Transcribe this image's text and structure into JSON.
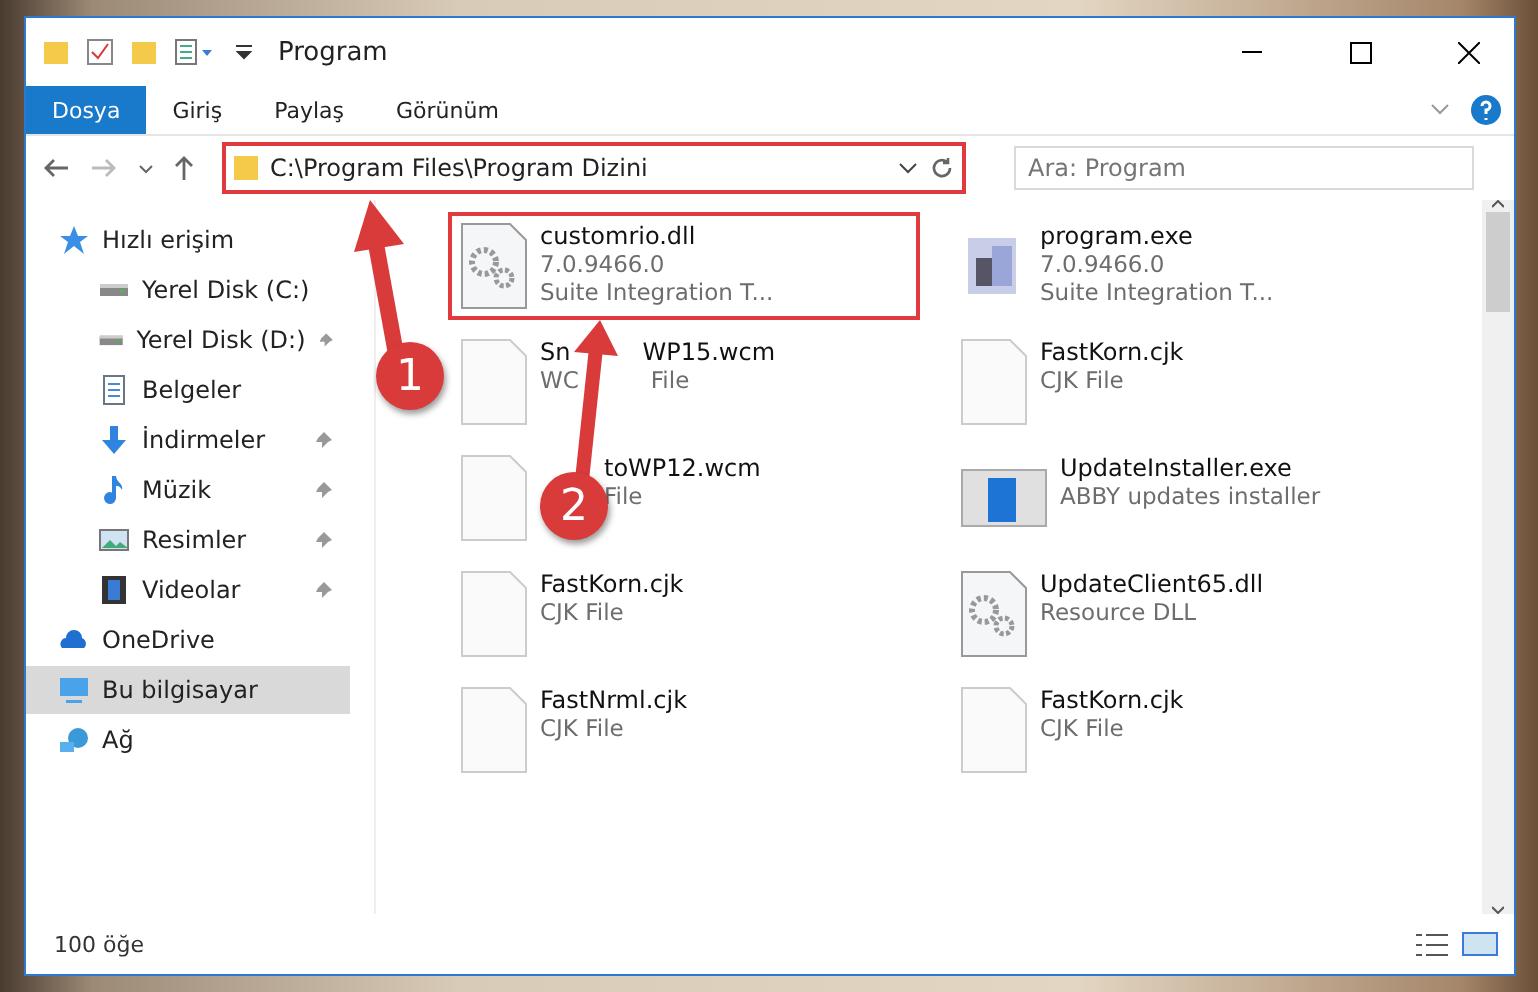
{
  "window": {
    "title": "Program"
  },
  "ribbon_tabs": [
    {
      "label": "Dosya",
      "selected": true
    },
    {
      "label": "Giriş",
      "selected": false
    },
    {
      "label": "Paylaş",
      "selected": false
    },
    {
      "label": "Görünüm",
      "selected": false
    }
  ],
  "address": {
    "path": "C:\\Program Files\\Program Dizini"
  },
  "search": {
    "placeholder": "Ara: Program"
  },
  "sidebar": {
    "items": [
      {
        "label": "Hızlı erişim",
        "kind": "star",
        "pinned": false,
        "selected": false,
        "children": [
          {
            "label": "Yerel Disk (C:)",
            "kind": "drive",
            "pinned": false,
            "selected": false
          },
          {
            "label": "Yerel Disk (D:)",
            "kind": "drive",
            "pinned": true,
            "selected": false
          },
          {
            "label": "Belgeler",
            "kind": "document",
            "pinned": false,
            "selected": false
          },
          {
            "label": "İndirmeler",
            "kind": "download",
            "pinned": true,
            "selected": false
          },
          {
            "label": "Müzik",
            "kind": "music",
            "pinned": true,
            "selected": false
          },
          {
            "label": "Resimler",
            "kind": "image",
            "pinned": true,
            "selected": false
          },
          {
            "label": "Videolar",
            "kind": "video",
            "pinned": true,
            "selected": false
          }
        ]
      },
      {
        "label": "OneDrive",
        "kind": "cloud",
        "pinned": false,
        "selected": false
      },
      {
        "label": "Bu bilgisayar",
        "kind": "computer",
        "pinned": false,
        "selected": true
      },
      {
        "label": "Ağ",
        "kind": "network",
        "pinned": false,
        "selected": false
      }
    ]
  },
  "files": [
    {
      "name": [
        "customrio.dll"
      ],
      "details": [
        [
          "7.0.9466.0"
        ],
        [
          "Suite Integration T..."
        ]
      ],
      "kind": "gear",
      "highlighted": true
    },
    {
      "name": [
        "program.exe"
      ],
      "details": [
        [
          "7.0.9466.0"
        ],
        [
          "Suite Integration T..."
        ]
      ],
      "kind": "app",
      "highlighted": false
    },
    {
      "name": [
        "Sn",
        "WP15.wcm"
      ],
      "details": [
        [
          "WC",
          "File"
        ]
      ],
      "kind": "blank",
      "highlighted": false
    },
    {
      "name": [
        "FastKorn.cjk"
      ],
      "details": [
        [
          "CJK File"
        ]
      ],
      "kind": "blank",
      "highlighted": false
    },
    {
      "name": [
        "toWP12.wcm"
      ],
      "details": [
        [
          "File"
        ]
      ],
      "kind": "blank",
      "highlighted": false
    },
    {
      "name": [
        "UpdateInstaller.exe"
      ],
      "details": [
        [
          "ABBY updates installer"
        ]
      ],
      "kind": "window",
      "highlighted": false
    },
    {
      "name": [
        "FastKorn.cjk"
      ],
      "details": [
        [
          "CJK File"
        ]
      ],
      "kind": "blank",
      "highlighted": false
    },
    {
      "name": [
        "UpdateClient65.dll"
      ],
      "details": [
        [
          "Resource DLL"
        ]
      ],
      "kind": "gear",
      "highlighted": false
    },
    {
      "name": [
        "FastNrml.cjk"
      ],
      "details": [
        [
          "CJK File"
        ]
      ],
      "kind": "blank",
      "highlighted": false
    },
    {
      "name": [
        "FastKorn.cjk"
      ],
      "details": [
        [
          "CJK File"
        ]
      ],
      "kind": "blank",
      "highlighted": false
    }
  ],
  "callouts": [
    "1",
    "2"
  ],
  "status_bar": {
    "count": "100 öğe"
  }
}
